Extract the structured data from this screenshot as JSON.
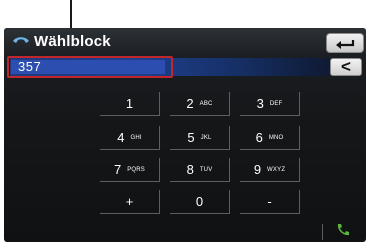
{
  "header": {
    "title": "Wählblock",
    "back_icon": "back-arrow-icon"
  },
  "number": {
    "value": "357"
  },
  "delete_label": "<",
  "keypad": [
    {
      "digit": "1",
      "letters": ""
    },
    {
      "digit": "2",
      "letters": "ABC"
    },
    {
      "digit": "3",
      "letters": "DEF"
    },
    {
      "digit": "4",
      "letters": "GHI"
    },
    {
      "digit": "5",
      "letters": "JKL"
    },
    {
      "digit": "6",
      "letters": "MNO"
    },
    {
      "digit": "7",
      "letters": "PQRS"
    },
    {
      "digit": "8",
      "letters": "TUV"
    },
    {
      "digit": "9",
      "letters": "WXYZ"
    },
    {
      "digit": "+",
      "letters": ""
    },
    {
      "digit": "0",
      "letters": ""
    },
    {
      "digit": "-",
      "letters": ""
    }
  ],
  "call_icon": "phone-handset-icon",
  "colors": {
    "highlight": "#c0262c",
    "field": "#1f3f8c",
    "accent_green": "#5bb43a"
  }
}
